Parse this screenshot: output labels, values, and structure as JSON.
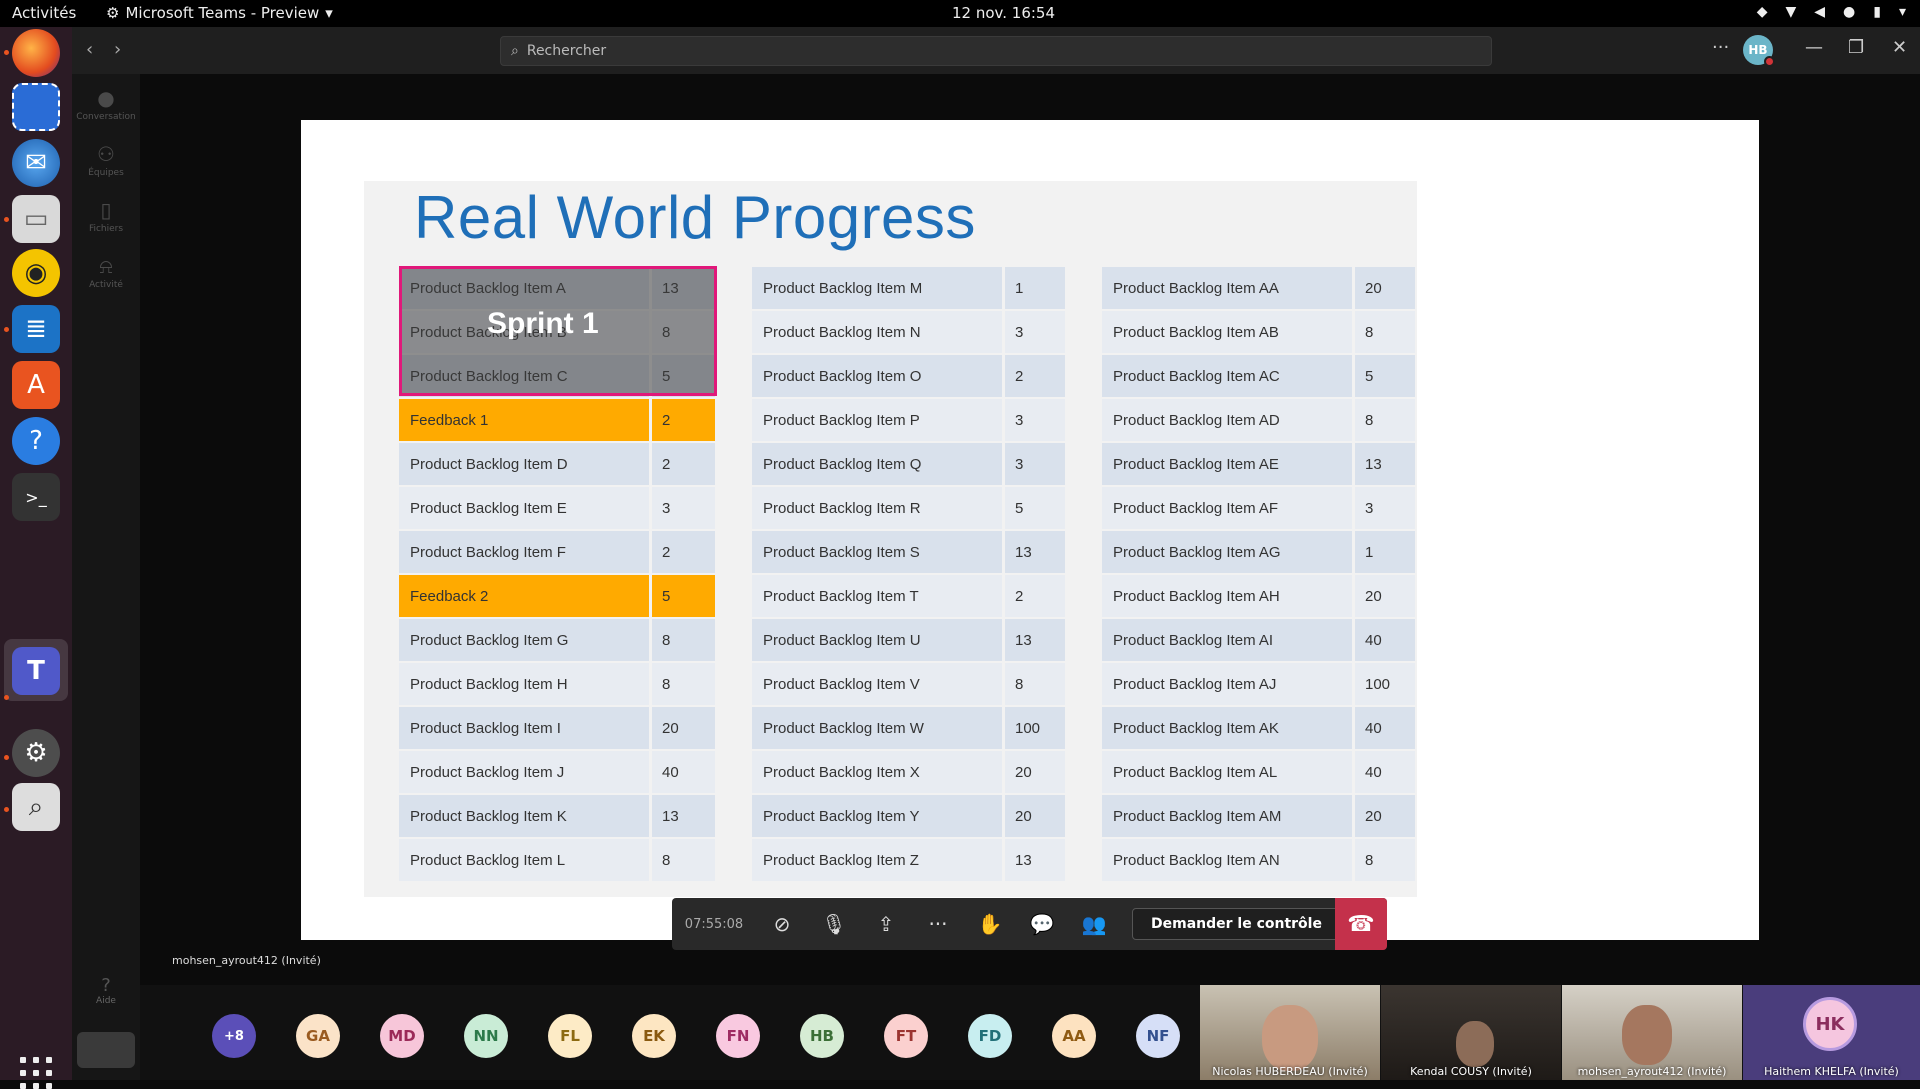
{
  "topbar": {
    "activities": "Activités",
    "app_name": "Microsoft Teams - Preview",
    "clock": "12 nov.  16:54"
  },
  "teams": {
    "search_placeholder": "Rechercher",
    "me_initials": "HB",
    "rail": [
      {
        "label": "Conversation",
        "icon": "chat-icon"
      },
      {
        "label": "Équipes",
        "icon": "teams-icon"
      },
      {
        "label": "Fichiers",
        "icon": "files-icon"
      },
      {
        "label": "Activité",
        "icon": "bell-icon"
      }
    ],
    "help_label": "Aide"
  },
  "slide": {
    "title": "Real World Progress",
    "sprint_label": "Sprint 1",
    "col1": [
      {
        "name": "Product Backlog Item A",
        "pts": "13"
      },
      {
        "name": "Product Backlog Item B",
        "pts": "8"
      },
      {
        "name": "Product Backlog Item C",
        "pts": "5"
      },
      {
        "name": "Feedback 1",
        "pts": "2",
        "feedback": true
      },
      {
        "name": "Product Backlog Item D",
        "pts": "2"
      },
      {
        "name": "Product Backlog Item E",
        "pts": "3"
      },
      {
        "name": "Product Backlog Item F",
        "pts": "2"
      },
      {
        "name": "Feedback 2",
        "pts": "5",
        "feedback": true
      },
      {
        "name": "Product Backlog Item G",
        "pts": "8"
      },
      {
        "name": "Product Backlog Item H",
        "pts": "8"
      },
      {
        "name": "Product Backlog Item I",
        "pts": "20"
      },
      {
        "name": "Product Backlog Item J",
        "pts": "40"
      },
      {
        "name": "Product Backlog Item K",
        "pts": "13"
      },
      {
        "name": "Product Backlog Item L",
        "pts": "8"
      }
    ],
    "col2": [
      {
        "name": "Product Backlog Item M",
        "pts": "1"
      },
      {
        "name": "Product Backlog Item N",
        "pts": "3"
      },
      {
        "name": "Product Backlog Item O",
        "pts": "2"
      },
      {
        "name": "Product Backlog Item P",
        "pts": "3"
      },
      {
        "name": "Product Backlog Item Q",
        "pts": "3"
      },
      {
        "name": "Product Backlog Item R",
        "pts": "5"
      },
      {
        "name": "Product Backlog Item S",
        "pts": "13"
      },
      {
        "name": "Product Backlog Item T",
        "pts": "2"
      },
      {
        "name": "Product Backlog Item U",
        "pts": "13"
      },
      {
        "name": "Product Backlog Item V",
        "pts": "8"
      },
      {
        "name": "Product Backlog Item W",
        "pts": "100"
      },
      {
        "name": "Product Backlog Item X",
        "pts": "20"
      },
      {
        "name": "Product Backlog Item Y",
        "pts": "20"
      },
      {
        "name": "Product Backlog Item Z",
        "pts": "13"
      }
    ],
    "col3": [
      {
        "name": "Product Backlog Item AA",
        "pts": "20"
      },
      {
        "name": "Product Backlog Item AB",
        "pts": "8"
      },
      {
        "name": "Product Backlog Item AC",
        "pts": "5"
      },
      {
        "name": "Product Backlog Item AD",
        "pts": "8"
      },
      {
        "name": "Product Backlog Item AE",
        "pts": "13"
      },
      {
        "name": "Product Backlog Item AF",
        "pts": "3"
      },
      {
        "name": "Product Backlog Item AG",
        "pts": "1"
      },
      {
        "name": "Product Backlog Item AH",
        "pts": "20"
      },
      {
        "name": "Product Backlog Item AI",
        "pts": "40"
      },
      {
        "name": "Product Backlog Item AJ",
        "pts": "100"
      },
      {
        "name": "Product Backlog Item AK",
        "pts": "40"
      },
      {
        "name": "Product Backlog Item AL",
        "pts": "40"
      },
      {
        "name": "Product Backlog Item AM",
        "pts": "20"
      },
      {
        "name": "Product Backlog Item AN",
        "pts": "8"
      }
    ]
  },
  "call": {
    "timer": "07:55:08",
    "request_control": "Demander le contrôle",
    "presenter": "mohsen_ayrout412 (Invité)"
  },
  "participants": {
    "overflow": "+8",
    "avatars": [
      {
        "initials": "GA",
        "bg": "#fbe3c8",
        "fg": "#9a5b20"
      },
      {
        "initials": "MD",
        "bg": "#f7c6d9",
        "fg": "#9b2a58"
      },
      {
        "initials": "NN",
        "bg": "#c9ecd6",
        "fg": "#2c7a4a"
      },
      {
        "initials": "FL",
        "bg": "#fdebc6",
        "fg": "#8c6a12"
      },
      {
        "initials": "EK",
        "bg": "#fde6c2",
        "fg": "#8a5a10"
      },
      {
        "initials": "FN",
        "bg": "#f9c9e0",
        "fg": "#9e2c63"
      },
      {
        "initials": "HB",
        "bg": "#d6ecd4",
        "fg": "#3b6f36"
      },
      {
        "initials": "FT",
        "bg": "#fbd0cf",
        "fg": "#9b3431"
      },
      {
        "initials": "FD",
        "bg": "#c8eef0",
        "fg": "#217078"
      },
      {
        "initials": "AA",
        "bg": "#fde2c0",
        "fg": "#8f5a12"
      },
      {
        "initials": "NF",
        "bg": "#d6dff7",
        "fg": "#33508f"
      }
    ],
    "videos": [
      {
        "label": "Nicolas HUBERDEAU (Invité)"
      },
      {
        "label": "Kendal COUSY (Invité)"
      },
      {
        "label": "mohsen_ayrout412 (Invité)"
      },
      {
        "label": "Haithem KHELFA (Invité)",
        "initials": "HK"
      }
    ]
  }
}
